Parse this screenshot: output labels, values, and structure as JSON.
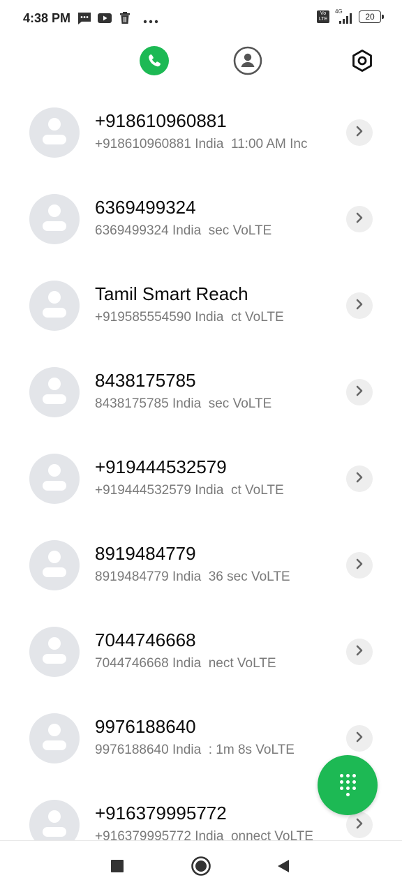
{
  "status_bar": {
    "time": "4:38 PM",
    "network": "4G",
    "volte_top": "Vo",
    "volte_bottom": "LTE",
    "battery": "20"
  },
  "icons": {
    "calls_tab": "phone-icon",
    "contacts_tab": "person-icon",
    "settings": "hexagon-settings-icon",
    "detail": "chevron-right-icon",
    "fab": "dialpad-icon"
  },
  "colors": {
    "accent": "#1db954",
    "avatar_bg": "#e3e5e9",
    "subtext": "#7a7a7a"
  },
  "calls": [
    {
      "name": "+918610960881",
      "number": "+918610960881",
      "country": "India",
      "extra": "11:00 AM Inc"
    },
    {
      "name": "6369499324",
      "number": "6369499324",
      "country": "India",
      "extra": "sec VoLTE"
    },
    {
      "name": "Tamil Smart Reach",
      "number": "+919585554590",
      "country": "India",
      "extra": "ct VoLTE"
    },
    {
      "name": "8438175785",
      "number": "8438175785",
      "country": "India",
      "extra": "sec VoLTE"
    },
    {
      "name": "+919444532579",
      "number": "+919444532579",
      "country": "India",
      "extra": "ct VoLTE"
    },
    {
      "name": "8919484779",
      "number": "8919484779",
      "country": "India",
      "extra": "36 sec VoLTE"
    },
    {
      "name": "7044746668",
      "number": "7044746668",
      "country": "India",
      "extra": "nect VoLTE"
    },
    {
      "name": "9976188640",
      "number": "9976188640",
      "country": "India",
      "extra": ": 1m 8s VoLTE"
    },
    {
      "name": "+916379995772",
      "number": "+916379995772",
      "country": "India",
      "extra": "onnect VoLTE"
    }
  ]
}
